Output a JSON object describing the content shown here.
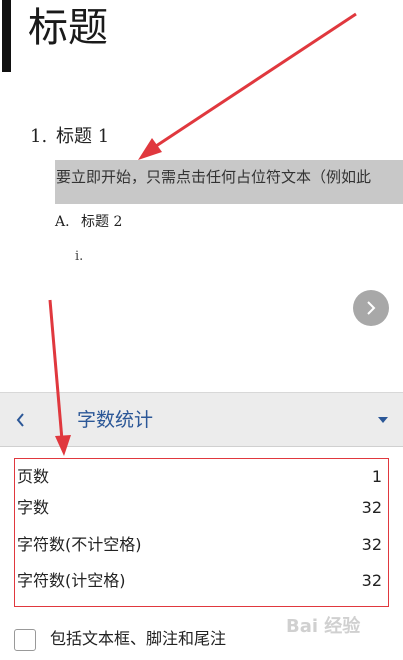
{
  "document": {
    "title": "标题",
    "heading1": {
      "number": "1.",
      "text": "标题 1"
    },
    "selected_text": "要立即开始，只需点击任何占位符文本（例如此",
    "heading2": {
      "number": "A.",
      "text": "标题 2"
    },
    "heading3": {
      "number": "i."
    }
  },
  "panel": {
    "title": "字数统计",
    "accent_color": "#2b5797",
    "stats": [
      {
        "label": "页数",
        "value": "1"
      },
      {
        "label": "字数",
        "value": "32"
      },
      {
        "label": "字符数(不计空格)",
        "value": "32"
      },
      {
        "label": "字符数(计空格)",
        "value": "32"
      }
    ],
    "checkbox": {
      "label": "包括文本框、脚注和尾注",
      "checked": false
    }
  },
  "annotations": {
    "highlight_color": "#e0383e"
  },
  "icons": {
    "back": "chevron-left-icon",
    "dropdown": "caret-down-icon",
    "next": "chevron-right-icon"
  },
  "watermark": "Bai 经验"
}
